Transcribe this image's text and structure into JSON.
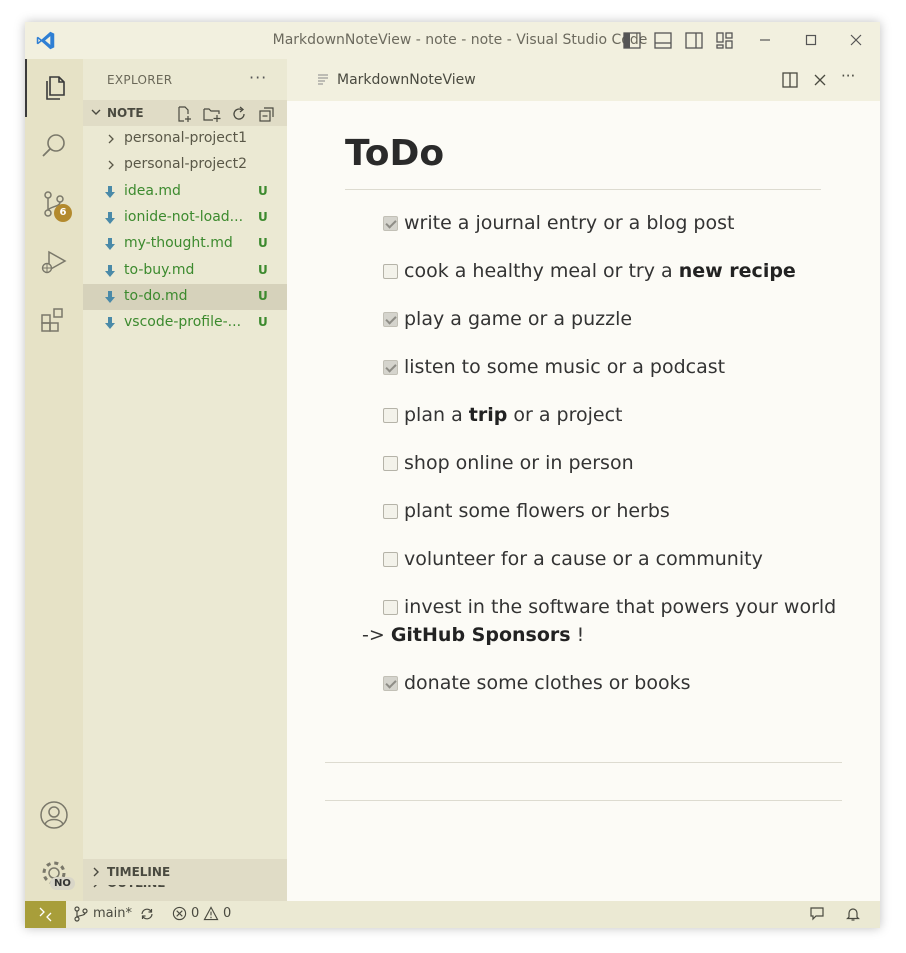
{
  "window": {
    "title": "MarkdownNoteView - note - note - Visual Studio Code"
  },
  "activity_bar": {
    "scm_badge": "6",
    "settings_badge": "NO"
  },
  "sidebar": {
    "header": "EXPLORER",
    "more": "···",
    "folder_section": "NOTE",
    "items": [
      {
        "name": "personal-project1",
        "type": "folder",
        "status": ""
      },
      {
        "name": "personal-project2",
        "type": "folder",
        "status": ""
      },
      {
        "name": "idea.md",
        "type": "file",
        "status": "U"
      },
      {
        "name": "ionide-not-load...",
        "type": "file",
        "status": "U"
      },
      {
        "name": "my-thought.md",
        "type": "file",
        "status": "U"
      },
      {
        "name": "to-buy.md",
        "type": "file",
        "status": "U"
      },
      {
        "name": "to-do.md",
        "type": "file",
        "status": "U",
        "selected": true
      },
      {
        "name": "vscode-profile-...",
        "type": "file",
        "status": "U"
      }
    ],
    "outline_label": "OUTLINE",
    "timeline_label": "TIMELINE"
  },
  "editor": {
    "tab_label": "MarkdownNoteView",
    "more": "···",
    "heading": "ToDo",
    "tasks": [
      {
        "checked": true,
        "parts": [
          {
            "t": "write a journal entry or a blog post"
          }
        ]
      },
      {
        "checked": false,
        "parts": [
          {
            "t": "cook a healthy meal or try a "
          },
          {
            "t": "new recipe",
            "b": true
          }
        ]
      },
      {
        "checked": true,
        "parts": [
          {
            "t": "play a game or a puzzle"
          }
        ]
      },
      {
        "checked": true,
        "parts": [
          {
            "t": "listen to some music or a podcast"
          }
        ]
      },
      {
        "checked": false,
        "parts": [
          {
            "t": "plan a "
          },
          {
            "t": "trip",
            "b": true
          },
          {
            "t": " or a project"
          }
        ]
      },
      {
        "checked": false,
        "parts": [
          {
            "t": "shop online or in person"
          }
        ]
      },
      {
        "checked": false,
        "parts": [
          {
            "t": "plant some flowers or herbs"
          }
        ]
      },
      {
        "checked": false,
        "parts": [
          {
            "t": "volunteer for a cause or a community"
          }
        ]
      },
      {
        "checked": false,
        "parts": [
          {
            "t": "invest in the software that powers your world"
          }
        ],
        "cont": [
          {
            "t": "-> "
          },
          {
            "t": "GitHub Sponsors",
            "b": true
          },
          {
            "t": " !"
          }
        ]
      },
      {
        "checked": true,
        "parts": [
          {
            "t": "donate some clothes or books"
          }
        ]
      }
    ]
  },
  "statusbar": {
    "branch": "main*",
    "errors": "0",
    "warnings": "0"
  },
  "colors": {
    "accent_remote": "#a89e3a",
    "file_untracked": "#3c8a2e",
    "badge": "#b38a2e"
  }
}
